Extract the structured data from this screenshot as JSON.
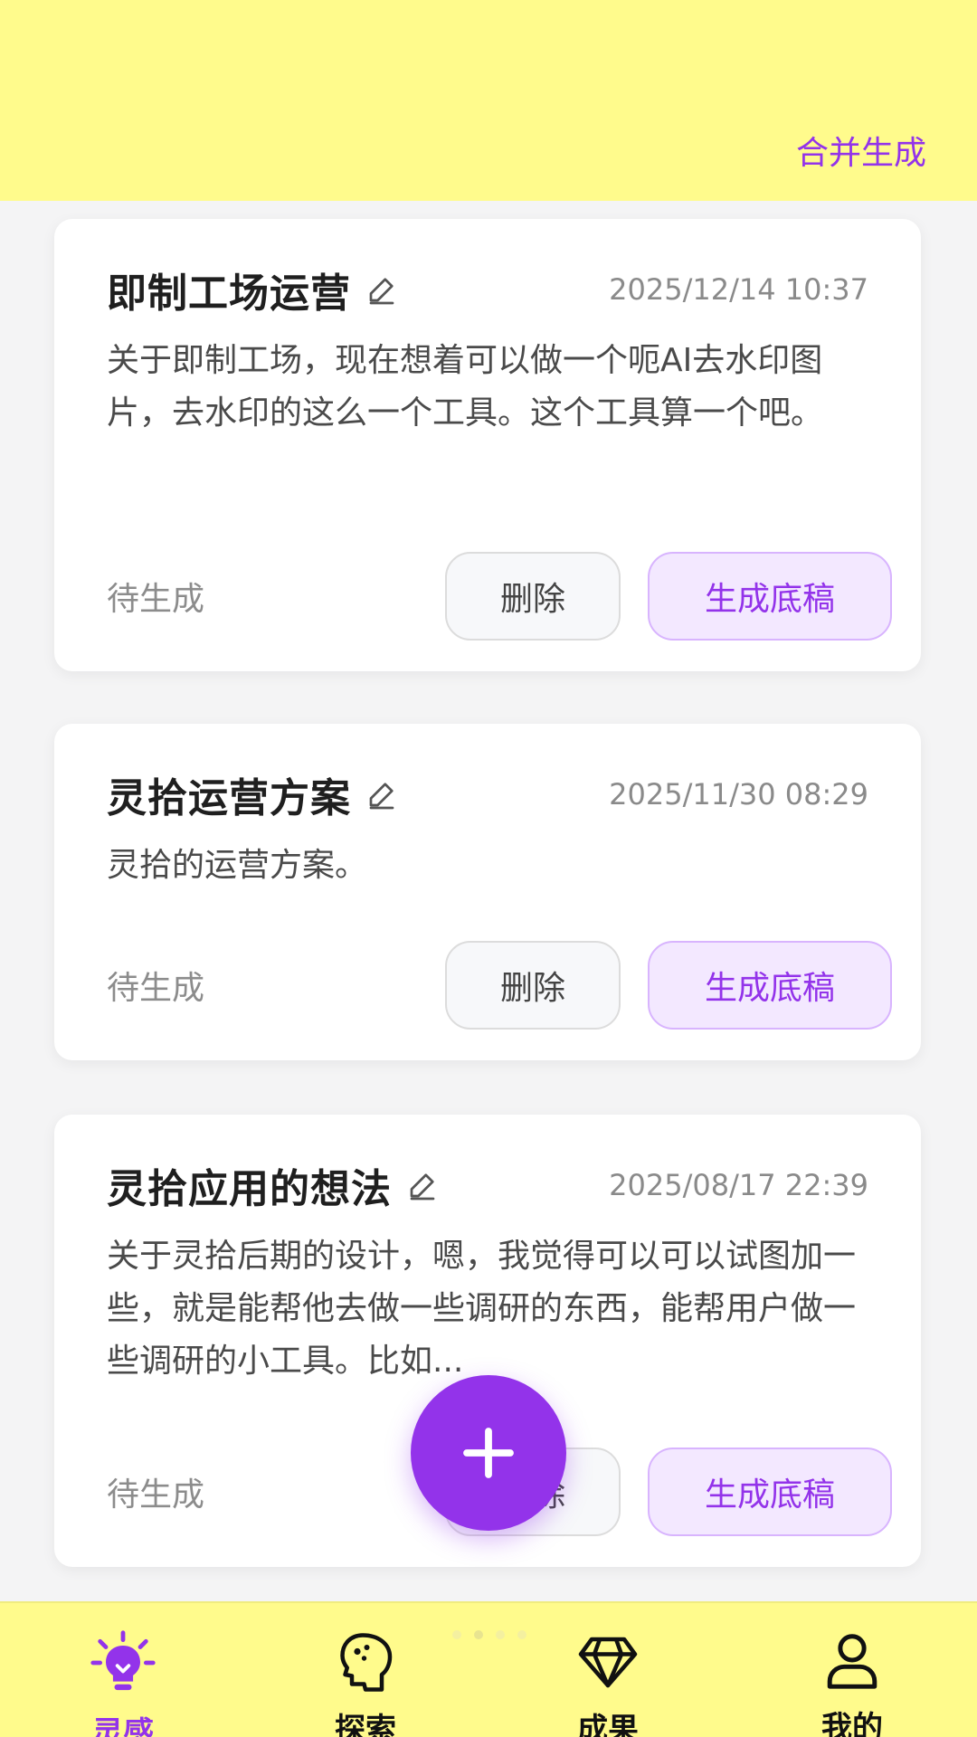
{
  "header": {
    "merge_label": "合并生成"
  },
  "cards": [
    {
      "title": "即制工场运营",
      "time": "2025/12/14 10:37",
      "body": "关于即制工场，现在想着可以做一个呃AI去水印图片，去水印的这么一个工具。这个工具算一个吧。",
      "status": "待生成",
      "delete_label": "删除",
      "generate_label": "生成底稿"
    },
    {
      "title": "灵拾运营方案",
      "time": "2025/11/30 08:29",
      "body": "灵拾的运营方案。",
      "status": "待生成",
      "delete_label": "删除",
      "generate_label": "生成底稿"
    },
    {
      "title": "灵拾应用的想法",
      "time": "2025/08/17 22:39",
      "body": "关于灵拾后期的设计，嗯，我觉得可以可以试图加一些，就是能帮他去做一些调研的东西，能帮用户做一些调研的小工具。比如...",
      "status": "待生成",
      "delete_label": "删除",
      "generate_label": "生成底稿"
    }
  ],
  "fab": {
    "icon": "plus-icon"
  },
  "nav": {
    "items": [
      {
        "label": "灵感",
        "icon": "lightbulb-icon",
        "active": true
      },
      {
        "label": "探索",
        "icon": "head-explore-icon",
        "active": false
      },
      {
        "label": "成果",
        "icon": "diamond-icon",
        "active": false
      },
      {
        "label": "我的",
        "icon": "user-icon",
        "active": false
      }
    ]
  },
  "colors": {
    "accent": "#9333ea",
    "header_bg": "#fffb8c",
    "page_bg": "#f4f4f5",
    "generate_bg": "#f3e8ff"
  }
}
